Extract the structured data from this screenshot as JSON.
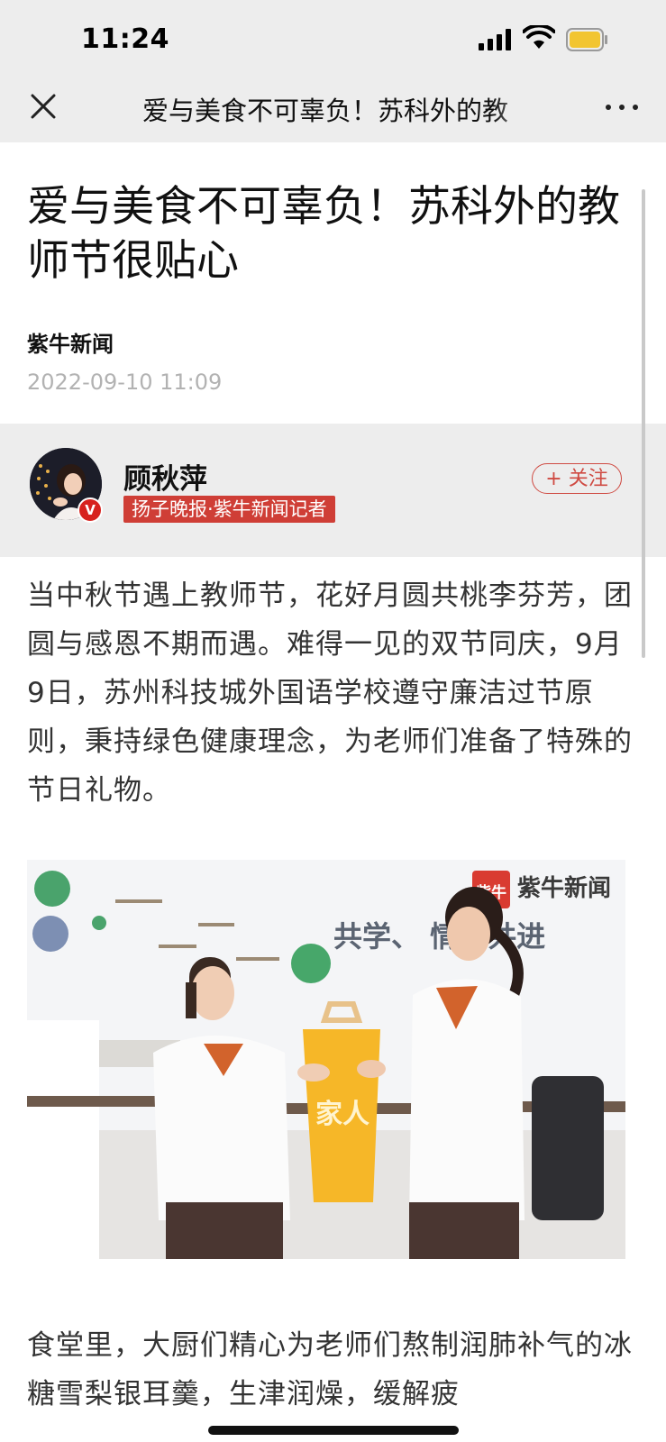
{
  "status_bar": {
    "time": "11:24",
    "icons": [
      "signal-icon",
      "wifi-icon",
      "battery-icon"
    ]
  },
  "nav": {
    "close_icon": "close-icon",
    "title": "爱与美食不可辜负！苏科外的教",
    "more_icon": "more-icon"
  },
  "article": {
    "title": "爱与美食不可辜负！苏科外的教师节很贴心",
    "source": "紫牛新闻",
    "date": "2022-09-10 11:09"
  },
  "author": {
    "name": "顾秋萍",
    "tag": "扬子晚报·紫牛新闻记者",
    "badge": "V",
    "follow_label": "+ 关注"
  },
  "paragraphs": [
    "当中秋节遇上教师节，花好月圆共桃李芬芳，团圆与感恩不期而遇。难得一见的双节同庆，9月9日，苏州科技城外国语学校遵守廉洁过节原则，秉持绿色健康理念，为老师们准备了特殊的节日礼物。",
    "食堂里，大厨们精心为老师们熬制润肺补气的冰糖雪梨银耳羹，生津润燥，缓解疲"
  ],
  "photo": {
    "watermark": "紫牛新闻",
    "watermark_logo": "紫牛",
    "wall_text": "共学、  情、共进",
    "bag_text": "家人"
  },
  "colors": {
    "accent_red": "#cf3e36",
    "topbar_bg": "#ededed",
    "date_gray": "#b2b2b2"
  }
}
